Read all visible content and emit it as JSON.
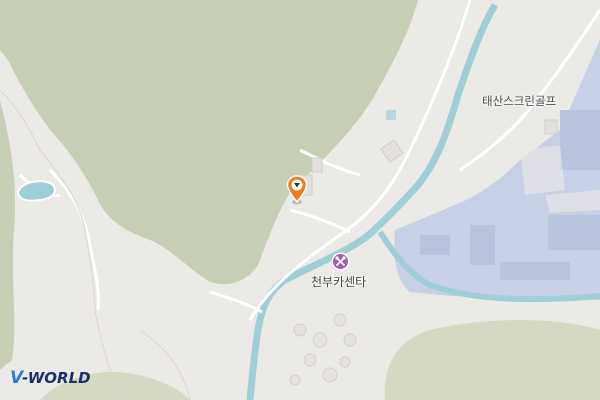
{
  "map": {
    "labels": {
      "golf": "태산스크린골프",
      "car_center": "천부카센타"
    },
    "marker_icon": "location-pin-icon",
    "poi_icon": "car-repair-icon",
    "logo": {
      "v": "V",
      "text": "-WORLD"
    },
    "colors": {
      "forest": "#c6cfb6",
      "land": "#eceae7",
      "river": "#9ecfd6",
      "industrial": "#c8d0e6",
      "marker": "#ef7d1a",
      "poi": "#a65bb0",
      "logo_accent": "#2a7be0",
      "logo_dark": "#1c2f6b"
    }
  }
}
